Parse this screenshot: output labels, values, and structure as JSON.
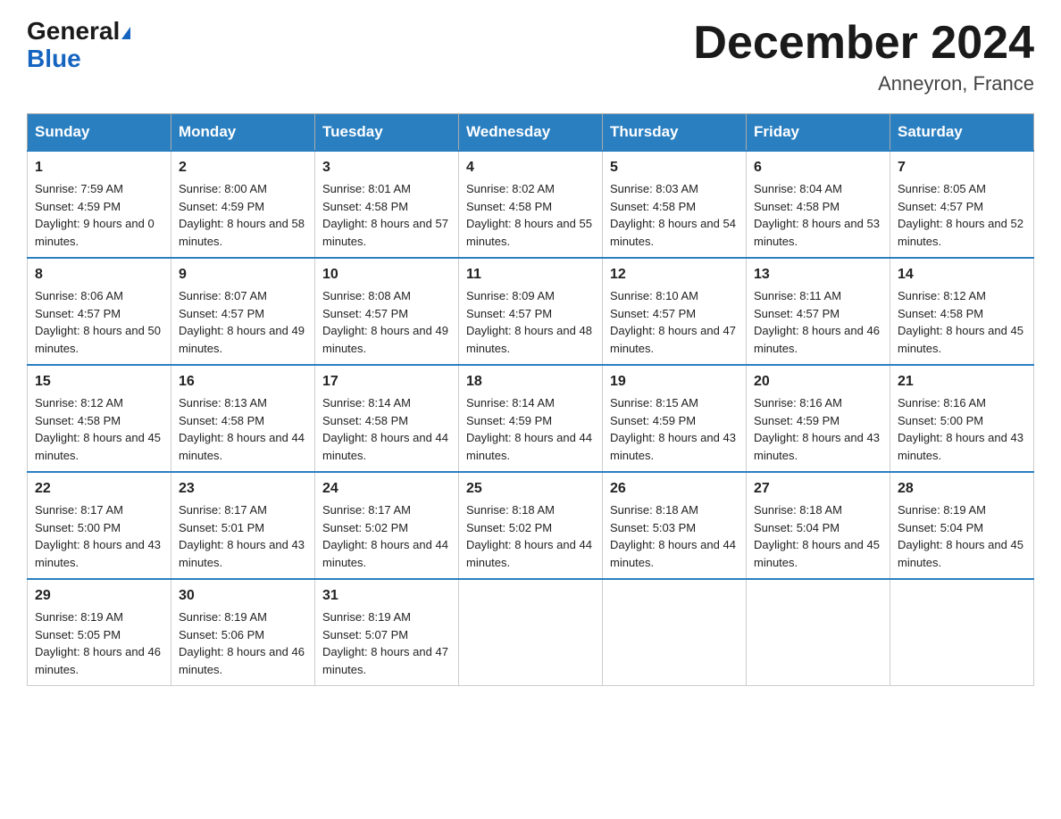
{
  "header": {
    "logo_line1": "General",
    "logo_line2": "Blue",
    "month_title": "December 2024",
    "location": "Anneyron, France"
  },
  "days_of_week": [
    "Sunday",
    "Monday",
    "Tuesday",
    "Wednesday",
    "Thursday",
    "Friday",
    "Saturday"
  ],
  "weeks": [
    [
      {
        "day": "1",
        "sunrise": "7:59 AM",
        "sunset": "4:59 PM",
        "daylight": "9 hours and 0 minutes."
      },
      {
        "day": "2",
        "sunrise": "8:00 AM",
        "sunset": "4:59 PM",
        "daylight": "8 hours and 58 minutes."
      },
      {
        "day": "3",
        "sunrise": "8:01 AM",
        "sunset": "4:58 PM",
        "daylight": "8 hours and 57 minutes."
      },
      {
        "day": "4",
        "sunrise": "8:02 AM",
        "sunset": "4:58 PM",
        "daylight": "8 hours and 55 minutes."
      },
      {
        "day": "5",
        "sunrise": "8:03 AM",
        "sunset": "4:58 PM",
        "daylight": "8 hours and 54 minutes."
      },
      {
        "day": "6",
        "sunrise": "8:04 AM",
        "sunset": "4:58 PM",
        "daylight": "8 hours and 53 minutes."
      },
      {
        "day": "7",
        "sunrise": "8:05 AM",
        "sunset": "4:57 PM",
        "daylight": "8 hours and 52 minutes."
      }
    ],
    [
      {
        "day": "8",
        "sunrise": "8:06 AM",
        "sunset": "4:57 PM",
        "daylight": "8 hours and 50 minutes."
      },
      {
        "day": "9",
        "sunrise": "8:07 AM",
        "sunset": "4:57 PM",
        "daylight": "8 hours and 49 minutes."
      },
      {
        "day": "10",
        "sunrise": "8:08 AM",
        "sunset": "4:57 PM",
        "daylight": "8 hours and 49 minutes."
      },
      {
        "day": "11",
        "sunrise": "8:09 AM",
        "sunset": "4:57 PM",
        "daylight": "8 hours and 48 minutes."
      },
      {
        "day": "12",
        "sunrise": "8:10 AM",
        "sunset": "4:57 PM",
        "daylight": "8 hours and 47 minutes."
      },
      {
        "day": "13",
        "sunrise": "8:11 AM",
        "sunset": "4:57 PM",
        "daylight": "8 hours and 46 minutes."
      },
      {
        "day": "14",
        "sunrise": "8:12 AM",
        "sunset": "4:58 PM",
        "daylight": "8 hours and 45 minutes."
      }
    ],
    [
      {
        "day": "15",
        "sunrise": "8:12 AM",
        "sunset": "4:58 PM",
        "daylight": "8 hours and 45 minutes."
      },
      {
        "day": "16",
        "sunrise": "8:13 AM",
        "sunset": "4:58 PM",
        "daylight": "8 hours and 44 minutes."
      },
      {
        "day": "17",
        "sunrise": "8:14 AM",
        "sunset": "4:58 PM",
        "daylight": "8 hours and 44 minutes."
      },
      {
        "day": "18",
        "sunrise": "8:14 AM",
        "sunset": "4:59 PM",
        "daylight": "8 hours and 44 minutes."
      },
      {
        "day": "19",
        "sunrise": "8:15 AM",
        "sunset": "4:59 PM",
        "daylight": "8 hours and 43 minutes."
      },
      {
        "day": "20",
        "sunrise": "8:16 AM",
        "sunset": "4:59 PM",
        "daylight": "8 hours and 43 minutes."
      },
      {
        "day": "21",
        "sunrise": "8:16 AM",
        "sunset": "5:00 PM",
        "daylight": "8 hours and 43 minutes."
      }
    ],
    [
      {
        "day": "22",
        "sunrise": "8:17 AM",
        "sunset": "5:00 PM",
        "daylight": "8 hours and 43 minutes."
      },
      {
        "day": "23",
        "sunrise": "8:17 AM",
        "sunset": "5:01 PM",
        "daylight": "8 hours and 43 minutes."
      },
      {
        "day": "24",
        "sunrise": "8:17 AM",
        "sunset": "5:02 PM",
        "daylight": "8 hours and 44 minutes."
      },
      {
        "day": "25",
        "sunrise": "8:18 AM",
        "sunset": "5:02 PM",
        "daylight": "8 hours and 44 minutes."
      },
      {
        "day": "26",
        "sunrise": "8:18 AM",
        "sunset": "5:03 PM",
        "daylight": "8 hours and 44 minutes."
      },
      {
        "day": "27",
        "sunrise": "8:18 AM",
        "sunset": "5:04 PM",
        "daylight": "8 hours and 45 minutes."
      },
      {
        "day": "28",
        "sunrise": "8:19 AM",
        "sunset": "5:04 PM",
        "daylight": "8 hours and 45 minutes."
      }
    ],
    [
      {
        "day": "29",
        "sunrise": "8:19 AM",
        "sunset": "5:05 PM",
        "daylight": "8 hours and 46 minutes."
      },
      {
        "day": "30",
        "sunrise": "8:19 AM",
        "sunset": "5:06 PM",
        "daylight": "8 hours and 46 minutes."
      },
      {
        "day": "31",
        "sunrise": "8:19 AM",
        "sunset": "5:07 PM",
        "daylight": "8 hours and 47 minutes."
      },
      null,
      null,
      null,
      null
    ]
  ]
}
